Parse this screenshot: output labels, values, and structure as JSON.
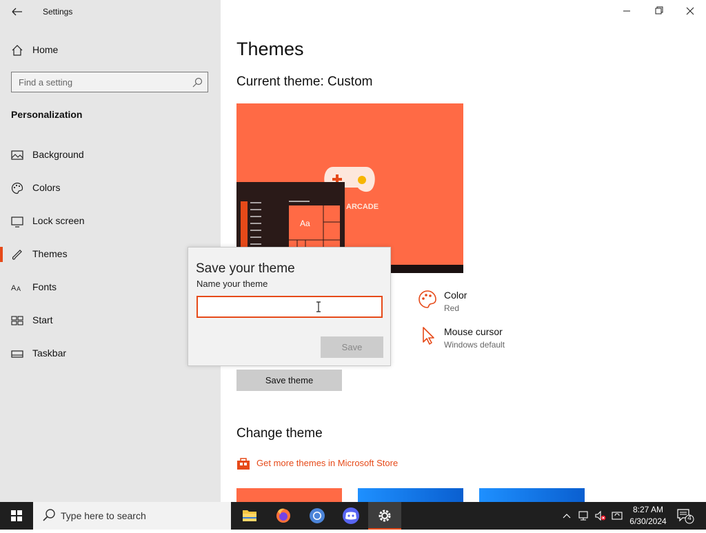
{
  "window": {
    "title": "Settings"
  },
  "sidebar": {
    "home_label": "Home",
    "search_placeholder": "Find a setting",
    "section_title": "Personalization",
    "items": [
      {
        "label": "Background",
        "icon": "image-icon"
      },
      {
        "label": "Colors",
        "icon": "palette-icon"
      },
      {
        "label": "Lock screen",
        "icon": "lock-screen-icon"
      },
      {
        "label": "Themes",
        "icon": "brush-icon",
        "active": true
      },
      {
        "label": "Fonts",
        "icon": "font-icon"
      },
      {
        "label": "Start",
        "icon": "start-icon"
      },
      {
        "label": "Taskbar",
        "icon": "taskbar-icon"
      }
    ]
  },
  "main": {
    "page_title": "Themes",
    "current_theme": "Current theme: Custom",
    "preview": {
      "text_arcade": "ARCADE",
      "tile_text": "Aa"
    },
    "properties": [
      {
        "title": "Color",
        "value": "Red",
        "icon": "palette-icon"
      },
      {
        "title": "Mouse cursor",
        "value": "Windows default",
        "icon": "cursor-icon"
      }
    ],
    "save_theme_label": "Save theme",
    "change_theme_title": "Change theme",
    "store_link": "Get more themes in Microsoft Store"
  },
  "dialog": {
    "title": "Save your theme",
    "label": "Name your theme",
    "input_value": "",
    "save_label": "Save"
  },
  "taskbar": {
    "search_placeholder": "Type here to search",
    "time": "8:27 AM",
    "date": "6/30/2024",
    "notification_count": "4"
  },
  "colors": {
    "accent": "#e64a19",
    "preview_bg": "#ff6a45",
    "sidebar_bg": "#e6e6e6",
    "taskbar_bg": "#1f1f1f"
  }
}
